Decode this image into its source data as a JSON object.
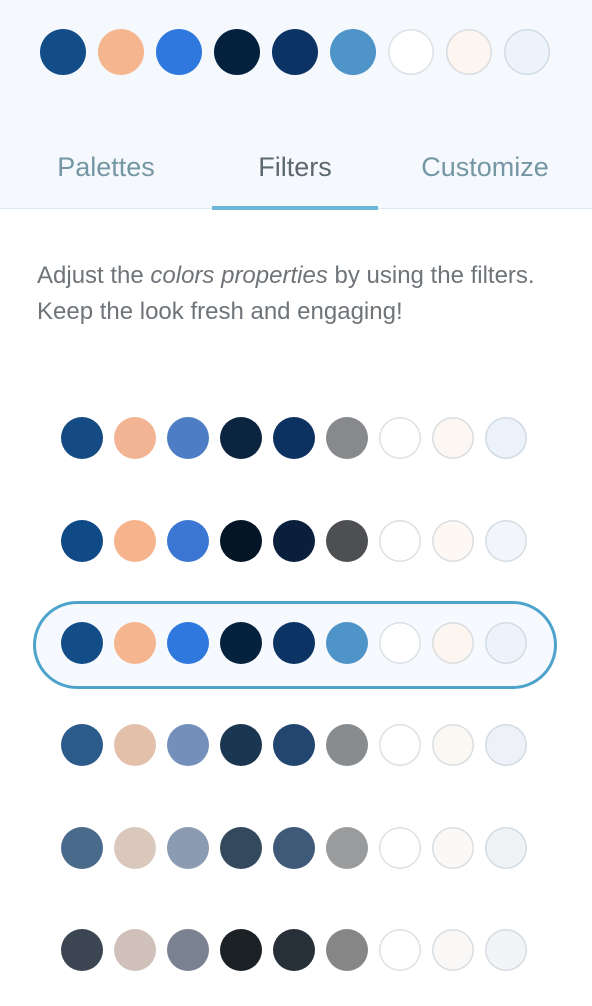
{
  "current_palette": {
    "colors": [
      "#124d88",
      "#f5b58e",
      "#2f78dd",
      "#04213e",
      "#0b3464",
      "#4e94c8",
      "#ffffff",
      "#fdf6f0",
      "#edf3fb"
    ]
  },
  "tabs": [
    {
      "label": "Palettes",
      "active": false
    },
    {
      "label": "Filters",
      "active": true
    },
    {
      "label": "Customize",
      "active": false
    }
  ],
  "description": {
    "prefix": "Adjust the ",
    "emphasis": "colors properties",
    "suffix": " by using the filters. Keep the look fresh and engaging!"
  },
  "filters": [
    {
      "selected": false,
      "colors": [
        "#144b82",
        "#f2b493",
        "#4d7dc5",
        "#0b2540",
        "#0d3261",
        "#87898c",
        "#ffffff",
        "#fcf7f2",
        "#ebf2fa"
      ]
    },
    {
      "selected": false,
      "colors": [
        "#0f4a86",
        "#f5b48c",
        "#3a76d2",
        "#041526",
        "#0a1f3c",
        "#4d4f52",
        "#ffffff",
        "#fdf8f4",
        "#f2f6fb"
      ]
    },
    {
      "selected": true,
      "colors": [
        "#124d88",
        "#f5b58e",
        "#2f78dd",
        "#04213e",
        "#0b3464",
        "#4e94c8",
        "#ffffff",
        "#fdf6f0",
        "#edf3fb"
      ]
    },
    {
      "selected": false,
      "colors": [
        "#2a5b8b",
        "#e3c0aa",
        "#7390bb",
        "#1b3651",
        "#234670",
        "#898c8f",
        "#ffffff",
        "#fbf8f4",
        "#eef2f8"
      ]
    },
    {
      "selected": false,
      "colors": [
        "#4a6a8b",
        "#dbc8bd",
        "#8a9bb2",
        "#34495e",
        "#3e5a78",
        "#9a9b9d",
        "#ffffff",
        "#fbf9f7",
        "#f0f3f6"
      ]
    },
    {
      "selected": false,
      "colors": [
        "#3c4652",
        "#cfc1ba",
        "#7a8190",
        "#1c2126",
        "#272f38",
        "#868686",
        "#ffffff",
        "#f9f8f7",
        "#f3f4f5"
      ]
    }
  ]
}
